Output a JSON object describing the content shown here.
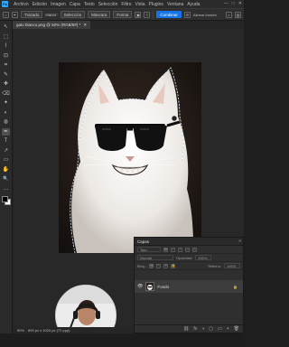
{
  "menu": [
    "Archivo",
    "Edición",
    "Imagen",
    "Capa",
    "Texto",
    "Selección",
    "Filtro",
    "Vista",
    "Plugins",
    "Ventana",
    "Ayuda"
  ],
  "window_controls": [
    "—",
    "□",
    "✕"
  ],
  "options": {
    "mode_label": "Trazado",
    "select_label": "Selección",
    "mask_label": "Máscara",
    "shape_label": "Forma",
    "align_label": "Alinear bordes",
    "combine_label": "Combinar"
  },
  "document_tab": {
    "title": "gato blanco.png @ 50% (RGB/8#) *",
    "close": "✕"
  },
  "tools": [
    "↖",
    "⬚",
    "⌇",
    "⊡",
    "⌗",
    "✎",
    "✚",
    "⌫",
    "✦",
    "◐",
    "◍",
    "✒",
    "T",
    "↗",
    "▭",
    "✋",
    "🔍",
    "…"
  ],
  "active_tool_index": 11,
  "layers_panel": {
    "title": "Capas",
    "collapse": "»",
    "kind_placeholder": "Tipo",
    "mode_value": "Normal",
    "opacity_value": "100%",
    "lock_label": "Bloq.:",
    "fill_value": "100%",
    "layer_name": "Fondo",
    "footer_icons": [
      "fx",
      "◑",
      "▢",
      "▭",
      "+",
      "🗑"
    ]
  },
  "status": {
    "zoom": "50%",
    "doc_size": "800 px x 1024 px (72 ppp)"
  }
}
